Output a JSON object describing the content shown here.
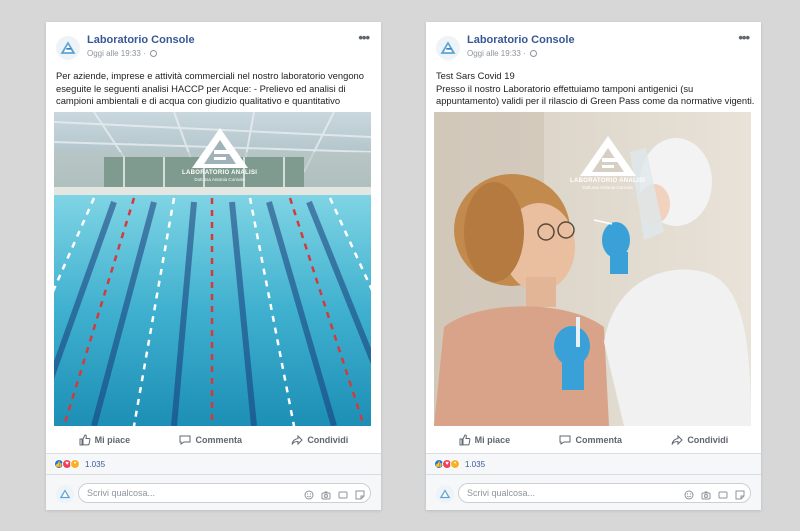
{
  "posts": [
    {
      "page_name": "Laboratorio Console",
      "timestamp": "Oggi alle 19:33",
      "text_lines": [
        "Per aziende, imprese e attività commerciali nel nostro laboratorio vengono",
        "eseguite le seguenti analisi HACCP per Acque: - Prelievo ed analisi di",
        "campioni ambientali e di acqua con giudizio qualitativo e quantitativo"
      ],
      "image_alt": "swimming-pool-photo",
      "logo_caption": "LABORATORIO ANALISI",
      "logo_sub": "Dott.ssa Antonia Console",
      "actions": {
        "like": "Mi piace",
        "comment": "Commenta",
        "share": "Condividi"
      },
      "reaction_count": "1.035",
      "comment_placeholder": "Scrivi qualcosa..."
    },
    {
      "page_name": "Laboratorio Console",
      "timestamp": "Oggi alle 19:33",
      "text_lines": [
        "Test Sars Covid 19",
        "Presso il nostro Laboratorio effettuiamo tamponi antigenici (su",
        "appuntamento) validi per il rilascio di Green Pass come da normative vigenti."
      ],
      "image_alt": "covid-swab-test-photo",
      "logo_caption": "LABORATORIO ANALISI",
      "logo_sub": "Dott.ssa Antonia Console",
      "actions": {
        "like": "Mi piace",
        "comment": "Commenta",
        "share": "Condividi"
      },
      "reaction_count": "1.035",
      "comment_placeholder": "Scrivi qualcosa..."
    }
  ],
  "colors": {
    "background": "#d7d7d7",
    "page_name": "#385898",
    "like_blue": "#1877f2",
    "love_red": "#f33e58",
    "wow_yellow": "#f7b125"
  },
  "icons": [
    "globe-icon",
    "more-options-icon",
    "like-icon",
    "comment-icon",
    "share-icon",
    "emoji-icon",
    "camera-icon",
    "gif-icon",
    "sticker-icon"
  ]
}
